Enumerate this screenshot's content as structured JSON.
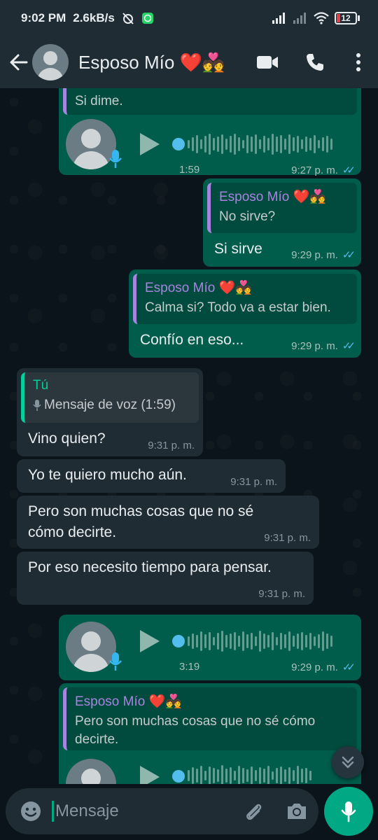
{
  "status_bar": {
    "time": "9:02 PM",
    "speed": "2.6kB/s",
    "battery": "12"
  },
  "header": {
    "contact_name": "Esposo Mío ❤️💑"
  },
  "messages": [
    {
      "type": "voice",
      "direction": "out",
      "quote_text": "Si dime.",
      "duration": "1:59",
      "time": "9:27 p. m.",
      "status": "read"
    },
    {
      "type": "text",
      "direction": "out",
      "quote_name": "Esposo Mío ❤️💑",
      "quote_text": "No sirve?",
      "text": "Si sirve",
      "time": "9:29 p. m.",
      "status": "read"
    },
    {
      "type": "text",
      "direction": "out",
      "quote_name": "Esposo Mío ❤️💑",
      "quote_text": "Calma si? Todo va a estar bien.",
      "text": "Confío en eso...",
      "time": "9:29 p. m.",
      "status": "read"
    },
    {
      "type": "text",
      "direction": "in",
      "quote_name": "Tú",
      "quote_text": "Mensaje de voz (1:59)",
      "text": "Vino quien?",
      "time": "9:31 p. m."
    },
    {
      "type": "text",
      "direction": "in",
      "text": "Yo te quiero mucho aún.",
      "time": "9:31 p. m."
    },
    {
      "type": "text",
      "direction": "in",
      "text_line1": "Pero son muchas cosas que no sé",
      "text_line2": "cómo decirte.",
      "time": "9:31 p. m."
    },
    {
      "type": "text",
      "direction": "in",
      "text": "Por eso necesito tiempo para pensar.",
      "time": "9:31 p. m."
    },
    {
      "type": "voice",
      "direction": "out",
      "duration": "3:19",
      "time": "9:29 p. m.",
      "status": "read"
    },
    {
      "type": "voice",
      "direction": "out",
      "quote_name": "Esposo Mío ❤️💑",
      "quote_line1": "Pero son muchas cosas que no sé cómo",
      "quote_line2": "decirte."
    }
  ],
  "composer": {
    "placeholder": "Mensaje"
  },
  "colors": {
    "outgoing_bubble": "#005c4b",
    "incoming_bubble": "#202c33",
    "accent": "#00a884",
    "read_ticks": "#53bdeb"
  }
}
